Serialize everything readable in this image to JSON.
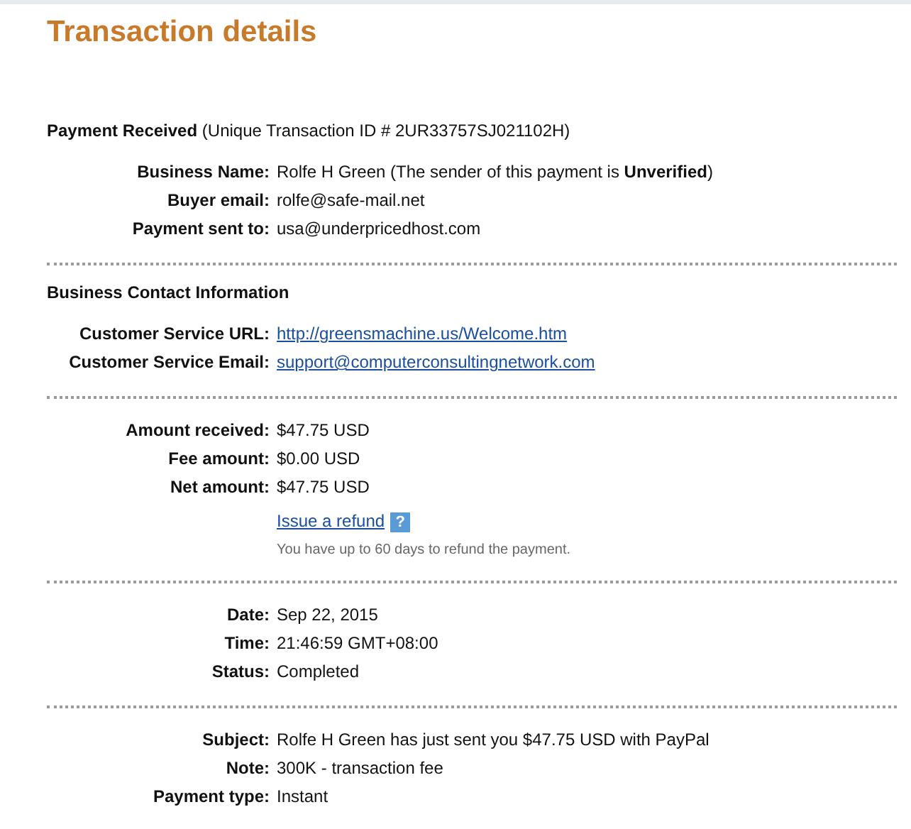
{
  "title": "Transaction details",
  "sections": [
    {
      "heading": "Payment Received",
      "heading_note": "(Unique Transaction ID # 2UR33757SJ021102H)",
      "rows": [
        {
          "kind": "text",
          "label": "Business Name:",
          "value": "Rolfe H Green (The sender of this payment is **Unverified**)"
        },
        {
          "kind": "text",
          "label": "Buyer email:",
          "value": "rolfe@safe-mail.net"
        },
        {
          "kind": "text",
          "label": "Payment sent to:",
          "value": "usa@underpricedhost.com"
        }
      ]
    },
    {
      "heading": "Business Contact Information",
      "rows": [
        {
          "kind": "link",
          "label": "Customer Service URL:",
          "value": "http://greensmachine.us/Welcome.htm"
        },
        {
          "kind": "link",
          "label": "Customer Service Email:",
          "value": "support@computerconsultingnetwork.com"
        }
      ]
    },
    {
      "rows": [
        {
          "kind": "text",
          "label": "Amount received:",
          "value": "$47.75 USD"
        },
        {
          "kind": "text",
          "label": "Fee amount:",
          "value": "$0.00 USD"
        },
        {
          "kind": "text",
          "label": "Net amount:",
          "value": "$47.75 USD"
        },
        {
          "kind": "action",
          "link": "Issue a refund",
          "help": "?",
          "hint": "You have up to 60 days to refund the payment."
        }
      ]
    },
    {
      "rows": [
        {
          "kind": "text",
          "label": "Date:",
          "value": "Sep 22, 2015"
        },
        {
          "kind": "text",
          "label": "Time:",
          "value": "21:46:59 GMT+08:00"
        },
        {
          "kind": "text",
          "label": "Status:",
          "value": "Completed"
        }
      ]
    },
    {
      "rows": [
        {
          "kind": "text",
          "label": "Subject:",
          "value": "Rolfe H Green has just sent you $47.75 USD with PayPal"
        },
        {
          "kind": "text",
          "label": "Note:",
          "value": "300K - transaction fee"
        },
        {
          "kind": "text",
          "label": "Payment type:",
          "value": "Instant"
        }
      ]
    }
  ]
}
